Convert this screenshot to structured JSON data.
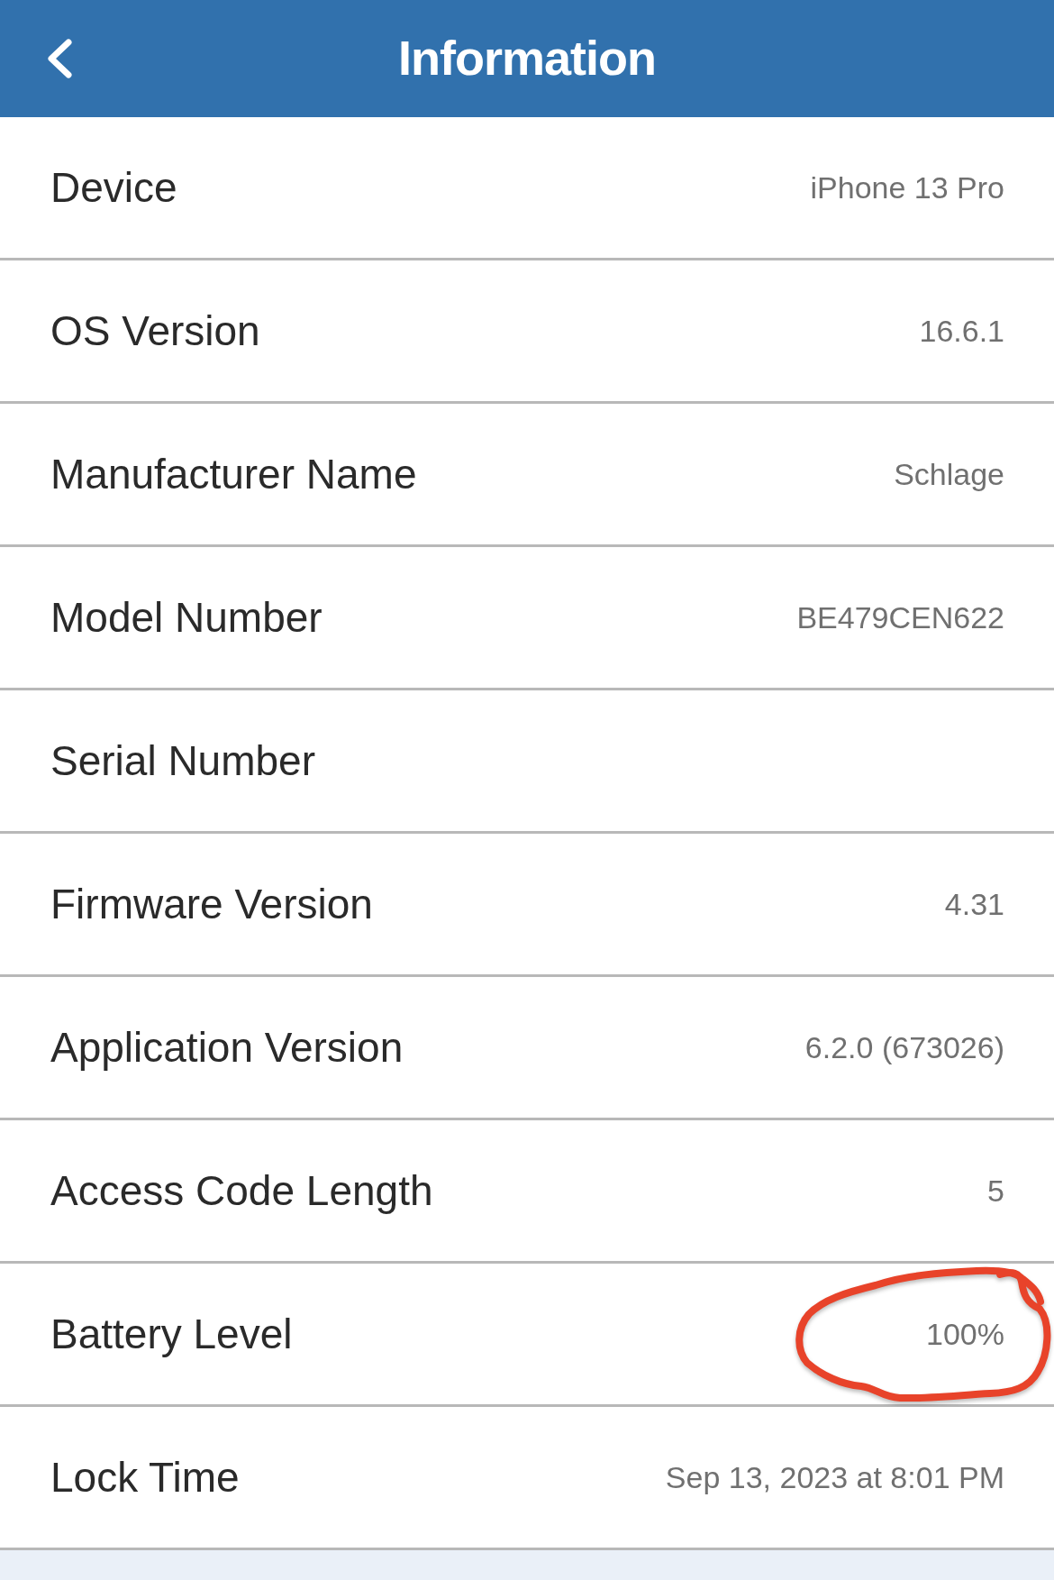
{
  "header": {
    "title": "Information"
  },
  "rows": [
    {
      "label": "Device",
      "value": "iPhone 13 Pro",
      "circled": false
    },
    {
      "label": "OS Version",
      "value": "16.6.1",
      "circled": false
    },
    {
      "label": "Manufacturer Name",
      "value": "Schlage",
      "circled": false
    },
    {
      "label": "Model Number",
      "value": "BE479CEN622",
      "circled": false
    },
    {
      "label": "Serial Number",
      "circled": false
    },
    {
      "label": "Firmware Version",
      "value": "4.31",
      "circled": false
    },
    {
      "label": "Application Version",
      "value": "6.2.0 (673026)",
      "circled": false
    },
    {
      "label": "Access Code Length",
      "value": "5",
      "circled": false
    },
    {
      "label": "Battery Level",
      "value": "100%",
      "circled": true
    },
    {
      "label": "Lock Time",
      "value": "Sep 13, 2023 at 8:01 PM",
      "circled": false
    }
  ]
}
